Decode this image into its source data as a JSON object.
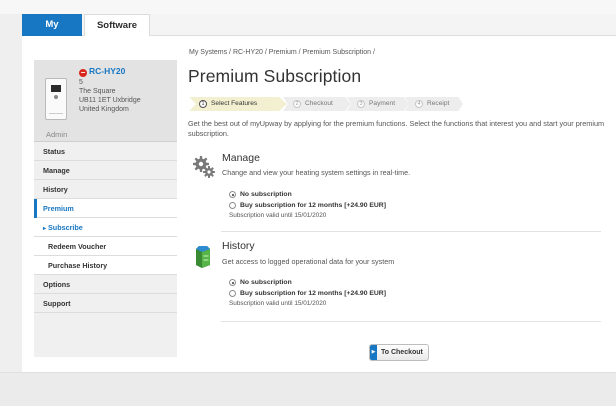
{
  "tabs": [
    {
      "label": "My Systems"
    },
    {
      "label": "Software"
    }
  ],
  "device": {
    "name": "RC-HY20",
    "number": "5",
    "address1": "The Square",
    "address2": "UB11 1ET Uxbridge",
    "country": "United Kingdom",
    "role": "Admin"
  },
  "sidebar": {
    "items": [
      {
        "label": "Status"
      },
      {
        "label": "Manage"
      },
      {
        "label": "History"
      },
      {
        "label": "Premium"
      },
      {
        "label": "Subscribe"
      },
      {
        "label": "Redeem Voucher"
      },
      {
        "label": "Purchase History"
      },
      {
        "label": "Options"
      },
      {
        "label": "Support"
      }
    ]
  },
  "breadcrumb": "My Systems / RC-HY20 / Premium / Premium Subscription /",
  "title": "Premium Subscription",
  "steps": [
    {
      "num": "1",
      "label": "Select Features"
    },
    {
      "num": "2",
      "label": "Checkout"
    },
    {
      "num": "3",
      "label": "Payment"
    },
    {
      "num": "4",
      "label": "Receipt"
    }
  ],
  "intro": "Get the best out of myUpway by applying for the premium functions. Select the functions that interest you and start your premium subscription.",
  "features": [
    {
      "title": "Manage",
      "description": "Change and view your heating system settings in real-time.",
      "icon": "gears-icon",
      "option_none": "No subscription",
      "option_buy": "Buy subscription for 12 months [+24.90 EUR]",
      "valid_until": "Subscription valid until 15/01/2020"
    },
    {
      "title": "History",
      "description": "Get access to logged operational data for your system",
      "icon": "history-icon",
      "option_none": "No subscription",
      "option_buy": "Buy subscription for 12 months [+24.90 EUR]",
      "valid_until": "Subscription valid until 15/01/2020"
    }
  ],
  "checkout_label": "To Checkout",
  "colors": {
    "accent": "#1877c2",
    "alert": "#d9261c",
    "step_active": "#f3f0d1"
  }
}
